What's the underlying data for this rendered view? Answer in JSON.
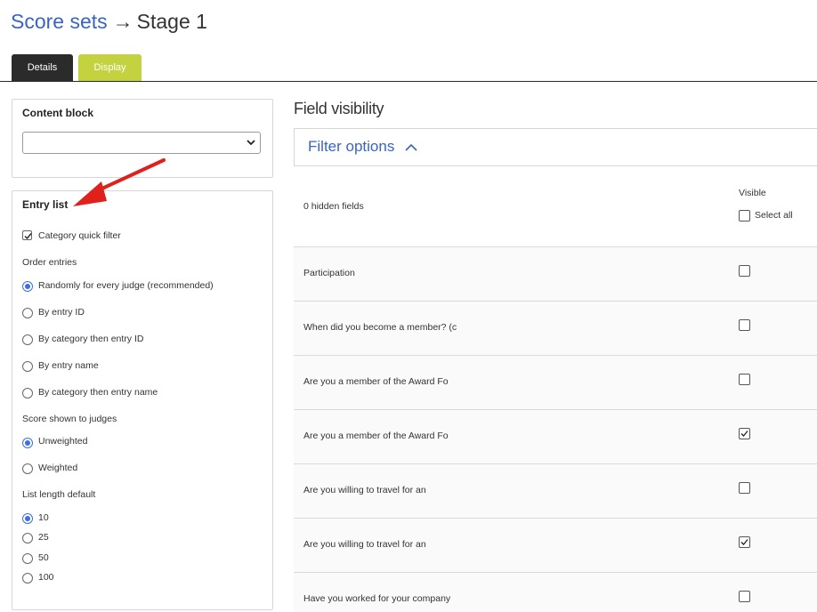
{
  "breadcrumb": {
    "parent": "Score sets",
    "separator": "→",
    "current": "Stage 1"
  },
  "tabs": {
    "details": "Details",
    "display": "Display"
  },
  "content_block": {
    "title": "Content block",
    "selected": ""
  },
  "entry_list": {
    "title": "Entry list",
    "category_quick_filter": {
      "label": "Category quick filter",
      "checked": true
    },
    "order_entries": {
      "label": "Order entries",
      "options": [
        {
          "label": "Randomly for every judge (recommended)",
          "selected": true
        },
        {
          "label": "By entry ID",
          "selected": false
        },
        {
          "label": "By category then entry ID",
          "selected": false
        },
        {
          "label": "By entry name",
          "selected": false
        },
        {
          "label": "By category then entry name",
          "selected": false
        }
      ]
    },
    "score_shown": {
      "label": "Score shown to judges",
      "options": [
        {
          "label": "Unweighted",
          "selected": true
        },
        {
          "label": "Weighted",
          "selected": false
        }
      ]
    },
    "list_length": {
      "label": "List length default",
      "options": [
        {
          "label": "10",
          "selected": true
        },
        {
          "label": "25",
          "selected": false
        },
        {
          "label": "50",
          "selected": false
        },
        {
          "label": "100",
          "selected": false
        }
      ]
    }
  },
  "field_visibility": {
    "title": "Field visibility",
    "filter_label": "Filter options",
    "hidden_count": "0 hidden fields",
    "visible_header": "Visible",
    "select_all": "Select all",
    "rows": [
      {
        "label": "Participation",
        "visible": false
      },
      {
        "label": "When did you become a member? (c",
        "visible": false
      },
      {
        "label": "Are you a member of the Award Fo",
        "visible": false
      },
      {
        "label": "Are you a member of the Award Fo",
        "visible": true
      },
      {
        "label": "Are you willing to travel for an",
        "visible": false
      },
      {
        "label": "Are you willing to travel for an",
        "visible": true
      },
      {
        "label": "Have you worked for your company",
        "visible": false
      }
    ]
  },
  "colors": {
    "link": "#3a63c4",
    "display_tab": "#c4d23f",
    "details_tab": "#2b2b2b",
    "radio": "#3b6ee6",
    "annotation_arrow": "#e0211b"
  }
}
